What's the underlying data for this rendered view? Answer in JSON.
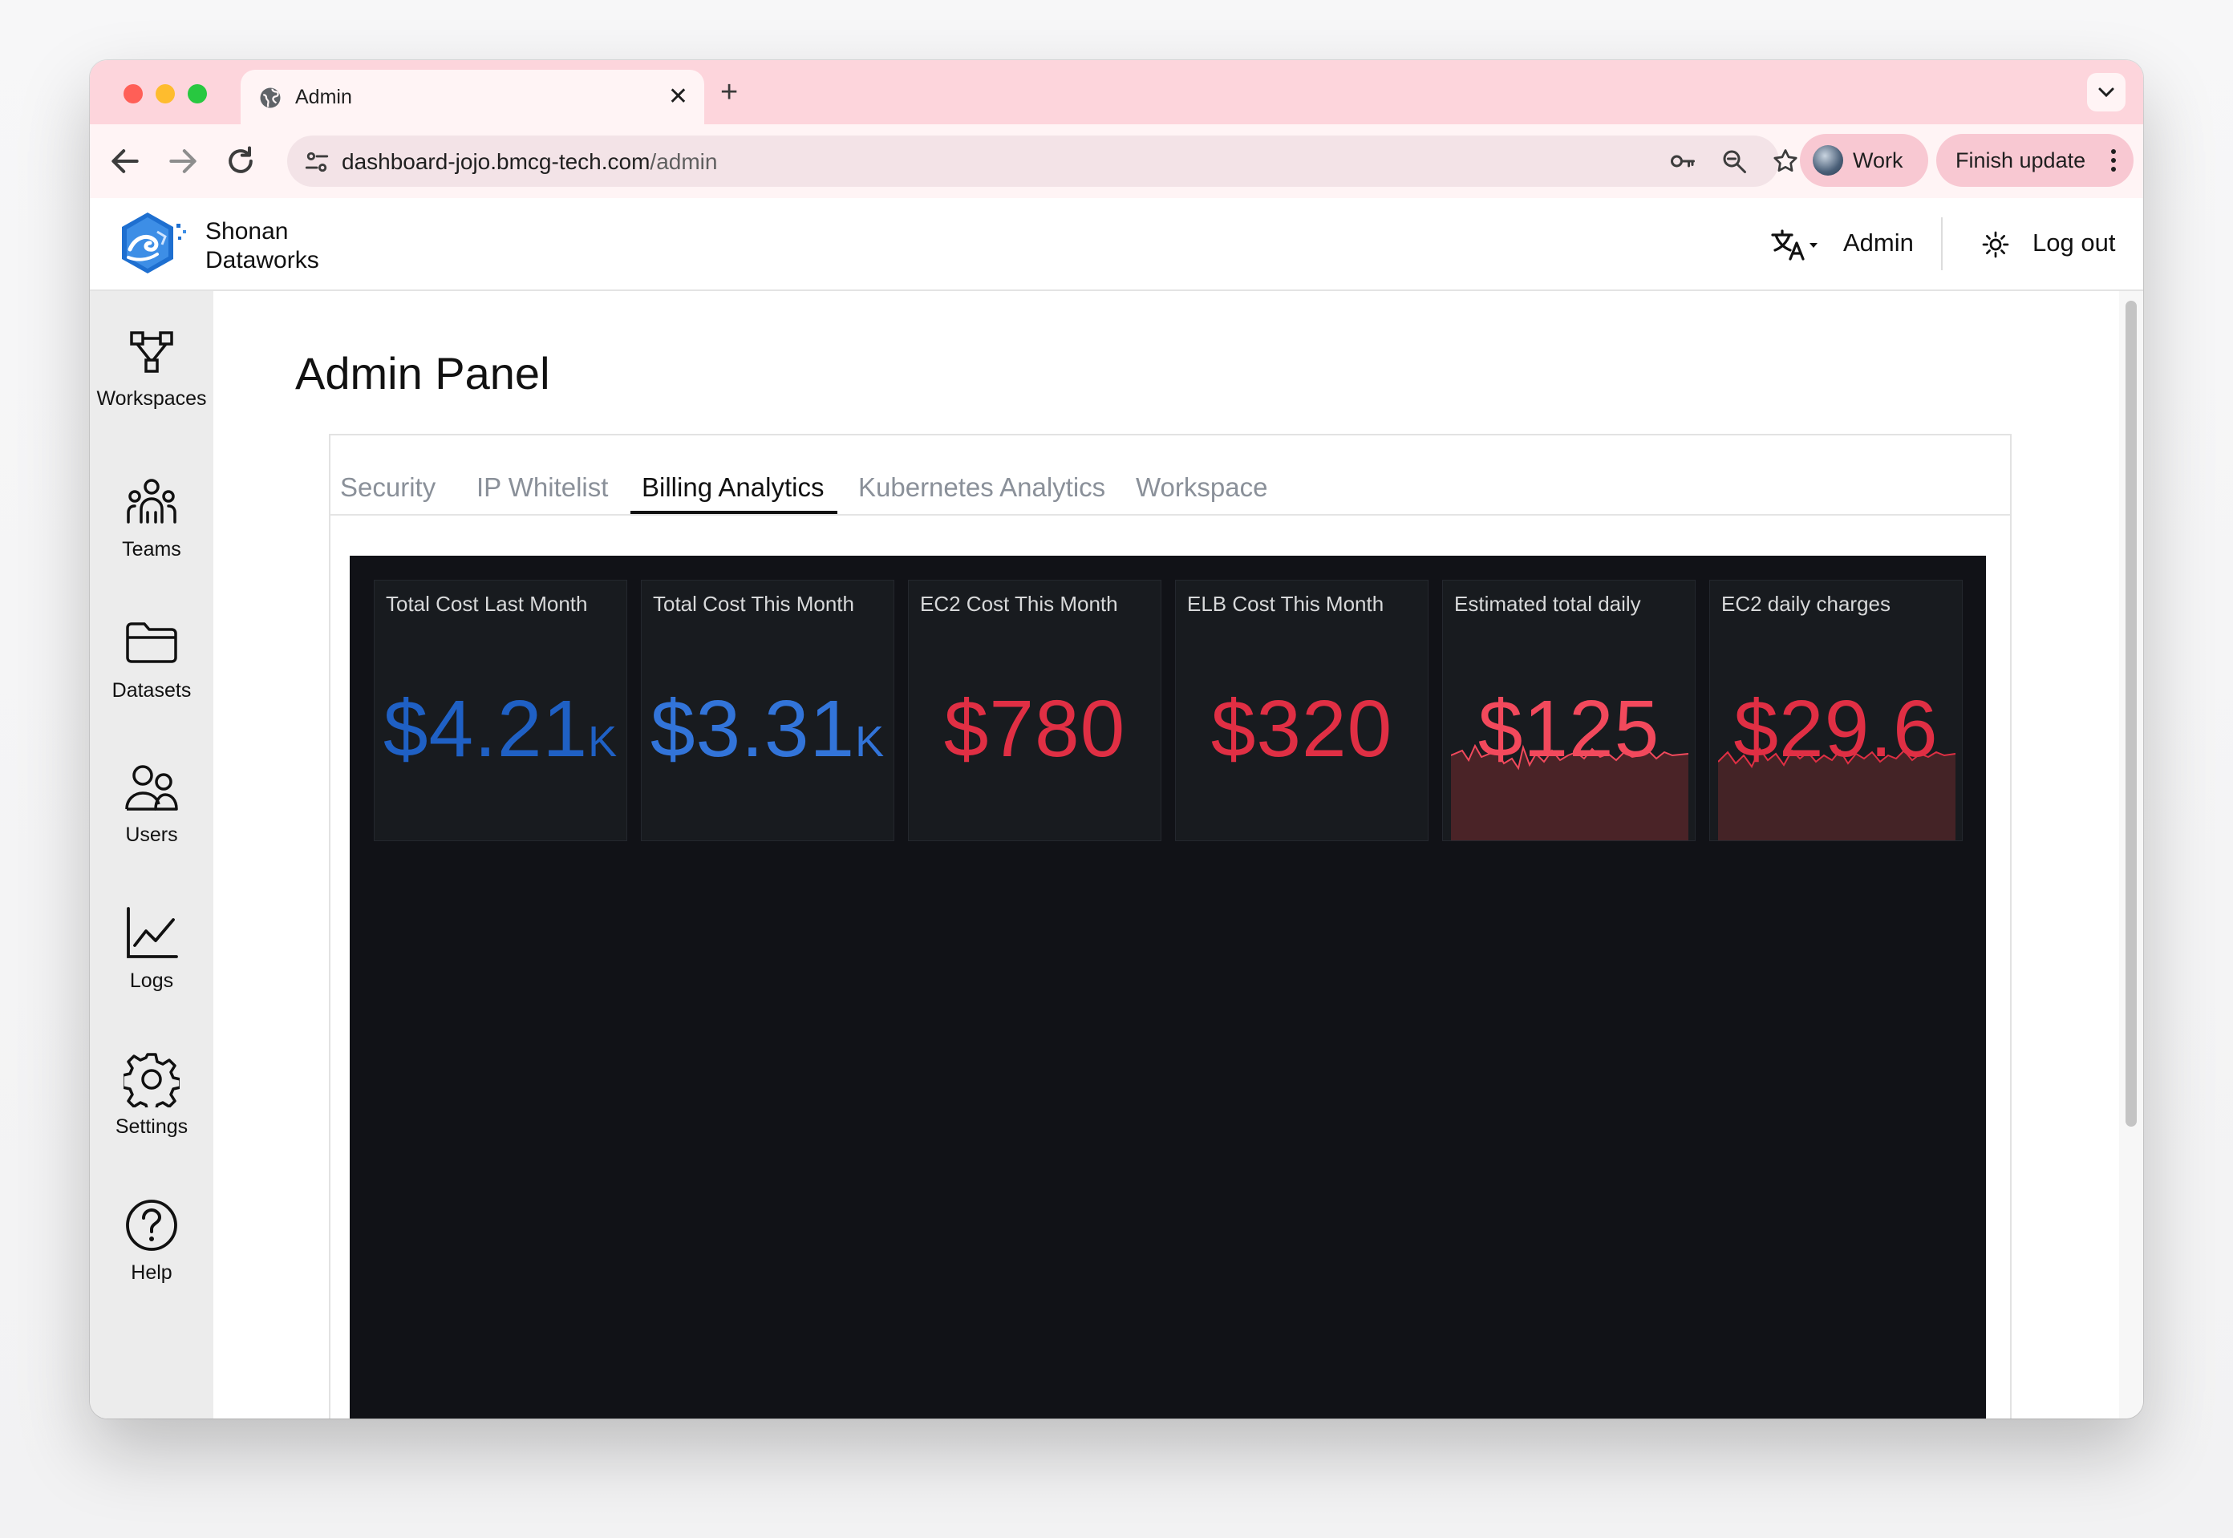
{
  "browser": {
    "tab_title": "Admin",
    "new_tab_symbol": "+",
    "close_symbol": "✕",
    "url_host": "dashboard-jojo.bmcg-tech.com",
    "url_path": "/admin",
    "profile_label": "Work",
    "update_label": "Finish update"
  },
  "header": {
    "brand_line1": "Shonan",
    "brand_line2": "Dataworks",
    "user_label": "Admin",
    "logout_label": "Log out"
  },
  "sidebar": {
    "items": [
      {
        "label": "Workspaces",
        "icon": "workspaces-icon"
      },
      {
        "label": "Teams",
        "icon": "teams-icon"
      },
      {
        "label": "Datasets",
        "icon": "folder-icon"
      },
      {
        "label": "Users",
        "icon": "users-icon"
      },
      {
        "label": "Logs",
        "icon": "chart-line-icon"
      },
      {
        "label": "Settings",
        "icon": "gear-icon"
      },
      {
        "label": "Help",
        "icon": "help-icon"
      }
    ]
  },
  "main": {
    "title": "Admin Panel",
    "tabs": [
      {
        "label": "Security",
        "active": false
      },
      {
        "label": "IP Whitelist",
        "active": false
      },
      {
        "label": "Billing Analytics",
        "active": true
      },
      {
        "label": "Kubernetes Analytics",
        "active": false
      },
      {
        "label": "Workspace",
        "active": false
      }
    ]
  },
  "dashboard": {
    "panels": [
      {
        "title": "Total Cost Last Month",
        "value": "$4.21",
        "unit": "K",
        "color": "#1f60c4"
      },
      {
        "title": "Total Cost This Month",
        "value": "$3.31",
        "unit": "K",
        "color": "#3274d9"
      },
      {
        "title": "EC2 Cost This Month",
        "value": "$780",
        "unit": "",
        "color": "#e02f44"
      },
      {
        "title": "ELB Cost This Month",
        "value": "$320",
        "unit": "",
        "color": "#e02f44"
      },
      {
        "title": "Estimated total daily",
        "value": "$125",
        "unit": "",
        "color": "#f2495c",
        "sparkline": true
      },
      {
        "title": "EC2 daily charges",
        "value": "$29.6",
        "unit": "",
        "color": "#e02f44",
        "sparkline": true
      }
    ]
  },
  "colors": {
    "tabstrip": "#fdd5dc",
    "dashboard_bg": "#111217",
    "panel_bg": "#181b1f"
  }
}
